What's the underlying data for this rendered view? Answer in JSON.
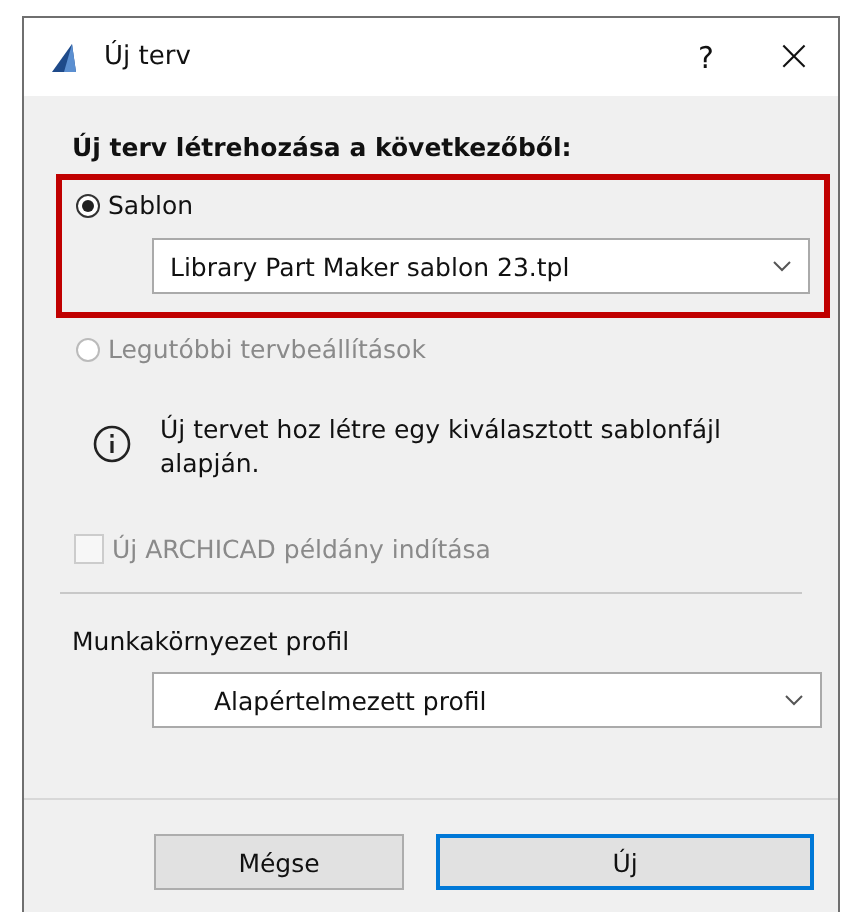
{
  "window": {
    "title": "Új terv",
    "help": "?",
    "close": "×"
  },
  "heading": "Új terv létrehozása a következőből:",
  "sources": [
    {
      "label": "Sablon",
      "selected": true,
      "disabled": false,
      "highlighted": true,
      "dropdown": "Library Part Maker sablon 23.tpl"
    },
    {
      "label": "Legutóbbi tervbeállítások",
      "selected": false,
      "disabled": true,
      "highlighted": false
    }
  ],
  "info": "Új tervet hoz létre egy kiválasztott sablonfájl alapján.",
  "new_instance": {
    "label": "Új ARCHICAD példány indítása",
    "checked": false,
    "disabled": true
  },
  "profile": {
    "label": "Munkakörnyezet profil",
    "value": "Alapértelmezett profil"
  },
  "buttons": [
    {
      "label": "Mégse",
      "default": false
    },
    {
      "label": "Új",
      "default": true
    }
  ]
}
